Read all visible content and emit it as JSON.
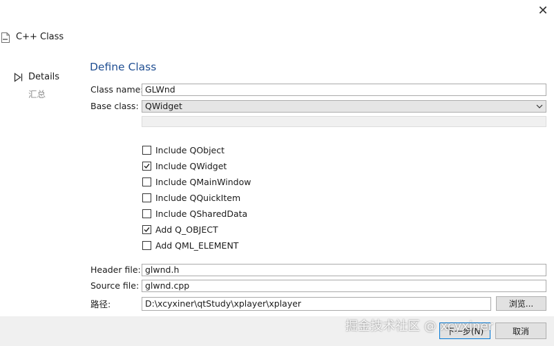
{
  "window": {
    "title": "C++ Class",
    "close_glyph": "✕"
  },
  "nav": {
    "items": [
      {
        "label": "Details",
        "active": true
      },
      {
        "label": "汇总",
        "active": false
      }
    ]
  },
  "page": {
    "title": "Define Class"
  },
  "form": {
    "class_name_label": "Class name:",
    "class_name_value": "GLWnd",
    "base_class_label": "Base class:",
    "base_class_value": "QWidget",
    "header_file_label": "Header file:",
    "header_file_value": "glwnd.h",
    "source_file_label": "Source file:",
    "source_file_value": "glwnd.cpp",
    "path_label": "路径:",
    "path_value": "D:\\xcyxiner\\qtStudy\\xplayer\\xplayer",
    "browse_label": "浏览..."
  },
  "checkboxes": [
    {
      "label": "Include QObject",
      "checked": false
    },
    {
      "label": "Include QWidget",
      "checked": true
    },
    {
      "label": "Include QMainWindow",
      "checked": false
    },
    {
      "label": "Include QQuickItem",
      "checked": false
    },
    {
      "label": "Include QSharedData",
      "checked": false
    },
    {
      "label": "Add Q_OBJECT",
      "checked": true
    },
    {
      "label": "Add QML_ELEMENT",
      "checked": false
    }
  ],
  "footer": {
    "next_label": "下一步(N)",
    "cancel_label": "取消"
  },
  "watermark": "掘金技术社区 @ xcyxiner",
  "colors": {
    "accent": "#1f4e92",
    "footer_bg": "#f0f0f0"
  }
}
